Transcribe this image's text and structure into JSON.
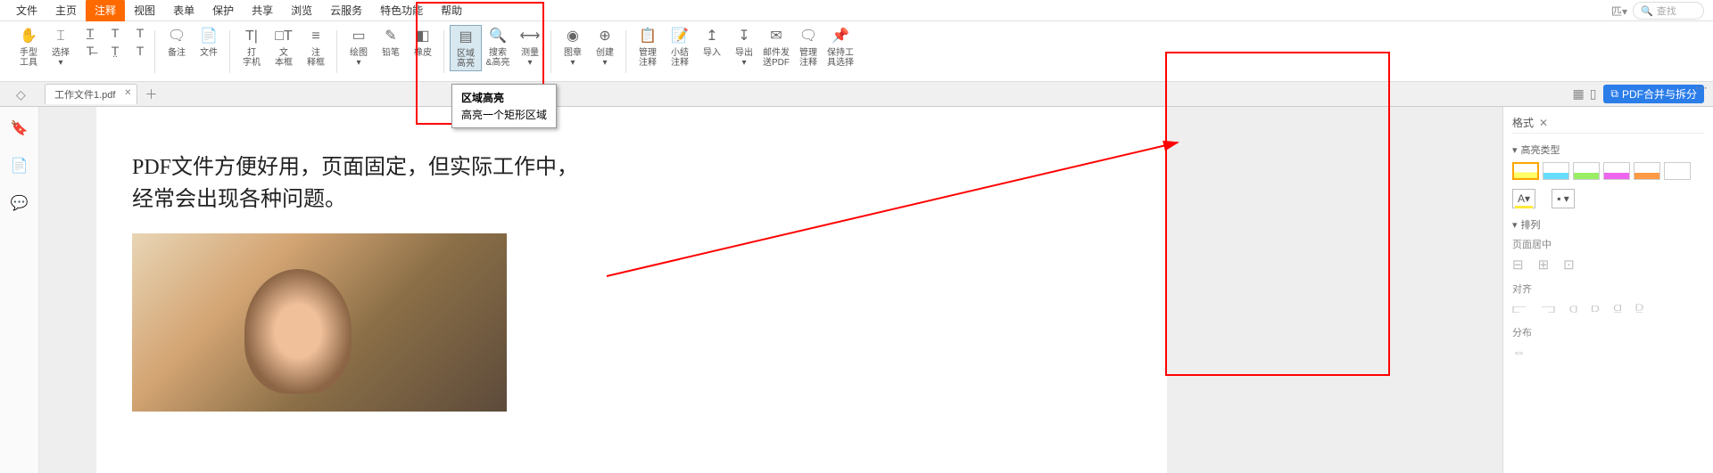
{
  "menu": [
    "文件",
    "主页",
    "注释",
    "视图",
    "表单",
    "保护",
    "共享",
    "浏览",
    "云服务",
    "特色功能",
    "帮助"
  ],
  "menu_active_index": 2,
  "search": {
    "dropdown": "匹▾",
    "icon": "🔍",
    "placeholder": "查找"
  },
  "ribbon": {
    "g1": [
      {
        "icon": "✋",
        "label": "手型\n工具"
      },
      {
        "icon": "⌶",
        "label": "选择\n▾"
      }
    ],
    "g1b_icons": [
      "T̲",
      "T",
      "T",
      "T̶",
      "T̤",
      "T"
    ],
    "g2": [
      {
        "icon": "🗨",
        "label": "备注"
      },
      {
        "icon": "📄",
        "label": "文件"
      }
    ],
    "g3": [
      {
        "icon": "T|",
        "label": "打\n字机"
      },
      {
        "icon": "□T",
        "label": "文\n本框"
      },
      {
        "icon": "≡",
        "label": "注\n释框"
      }
    ],
    "g4": [
      {
        "icon": "▭",
        "label": "绘图\n▾"
      },
      {
        "icon": "✎",
        "label": "铅笔"
      },
      {
        "icon": "◧",
        "label": "橡皮"
      }
    ],
    "g5": [
      {
        "icon": "▤",
        "label": "区域\n高亮",
        "selected": true
      },
      {
        "icon": "🔍",
        "label": "搜索\n&高亮"
      },
      {
        "icon": "⟷",
        "label": "测量\n▾"
      }
    ],
    "g6": [
      {
        "icon": "◉",
        "label": "图章\n▾"
      },
      {
        "icon": "⊕",
        "label": "创建\n▾"
      }
    ],
    "g7": [
      {
        "icon": "📋",
        "label": "管理\n注释"
      },
      {
        "icon": "📝",
        "label": "小结\n注释"
      },
      {
        "icon": "↥",
        "label": "导入"
      },
      {
        "icon": "↧",
        "label": "导出\n▾"
      },
      {
        "icon": "✉",
        "label": "邮件发\n送PDF"
      },
      {
        "icon": "🗨",
        "label": "管理\n注释"
      },
      {
        "icon": "📌",
        "label": "保持工\n具选择"
      }
    ]
  },
  "tab": {
    "name": "工作文件1.pdf",
    "merge_label": "PDF合并与拆分"
  },
  "tooltip": {
    "title": "区域高亮",
    "desc": "高亮一个矩形区域"
  },
  "document": {
    "line1": "PDF文件方便好用，页面固定，但实际工作中，",
    "line2": "经常会出现各种问题。"
  },
  "format_panel": {
    "tab": "格式",
    "hl_type": "高亮类型",
    "swatches": [
      "#ffff66",
      "#66ddff",
      "#99ee66",
      "#ee66ee",
      "#ff9944",
      "#ffffff"
    ],
    "arrangement": "排列",
    "page_center": "页面居中",
    "align": "对齐",
    "distribute": "分布"
  }
}
